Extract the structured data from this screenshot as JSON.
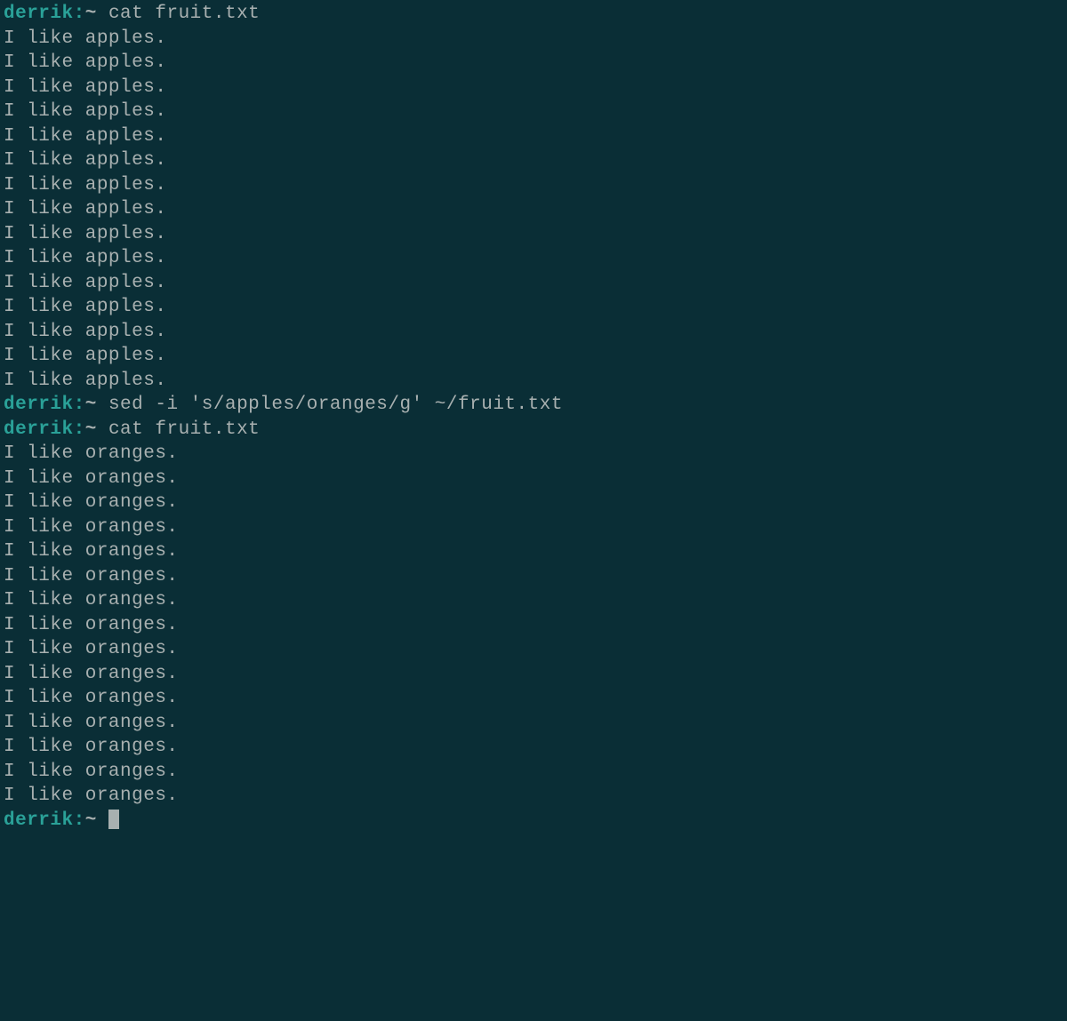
{
  "prompt": {
    "user": "derrik",
    "separator": ":",
    "path": "~",
    "suffix": " "
  },
  "lines": [
    {
      "type": "command",
      "text": "cat fruit.txt"
    },
    {
      "type": "output",
      "text": "I like apples."
    },
    {
      "type": "output",
      "text": "I like apples."
    },
    {
      "type": "output",
      "text": "I like apples."
    },
    {
      "type": "output",
      "text": "I like apples."
    },
    {
      "type": "output",
      "text": "I like apples."
    },
    {
      "type": "output",
      "text": "I like apples."
    },
    {
      "type": "output",
      "text": "I like apples."
    },
    {
      "type": "output",
      "text": "I like apples."
    },
    {
      "type": "output",
      "text": "I like apples."
    },
    {
      "type": "output",
      "text": "I like apples."
    },
    {
      "type": "output",
      "text": "I like apples."
    },
    {
      "type": "output",
      "text": "I like apples."
    },
    {
      "type": "output",
      "text": "I like apples."
    },
    {
      "type": "output",
      "text": "I like apples."
    },
    {
      "type": "output",
      "text": "I like apples."
    },
    {
      "type": "command",
      "text": "sed -i 's/apples/oranges/g' ~/fruit.txt"
    },
    {
      "type": "command",
      "text": "cat fruit.txt"
    },
    {
      "type": "output",
      "text": "I like oranges."
    },
    {
      "type": "output",
      "text": "I like oranges."
    },
    {
      "type": "output",
      "text": "I like oranges."
    },
    {
      "type": "output",
      "text": "I like oranges."
    },
    {
      "type": "output",
      "text": "I like oranges."
    },
    {
      "type": "output",
      "text": "I like oranges."
    },
    {
      "type": "output",
      "text": "I like oranges."
    },
    {
      "type": "output",
      "text": "I like oranges."
    },
    {
      "type": "output",
      "text": "I like oranges."
    },
    {
      "type": "output",
      "text": "I like oranges."
    },
    {
      "type": "output",
      "text": "I like oranges."
    },
    {
      "type": "output",
      "text": "I like oranges."
    },
    {
      "type": "output",
      "text": "I like oranges."
    },
    {
      "type": "output",
      "text": "I like oranges."
    },
    {
      "type": "output",
      "text": "I like oranges."
    },
    {
      "type": "prompt_cursor"
    }
  ]
}
